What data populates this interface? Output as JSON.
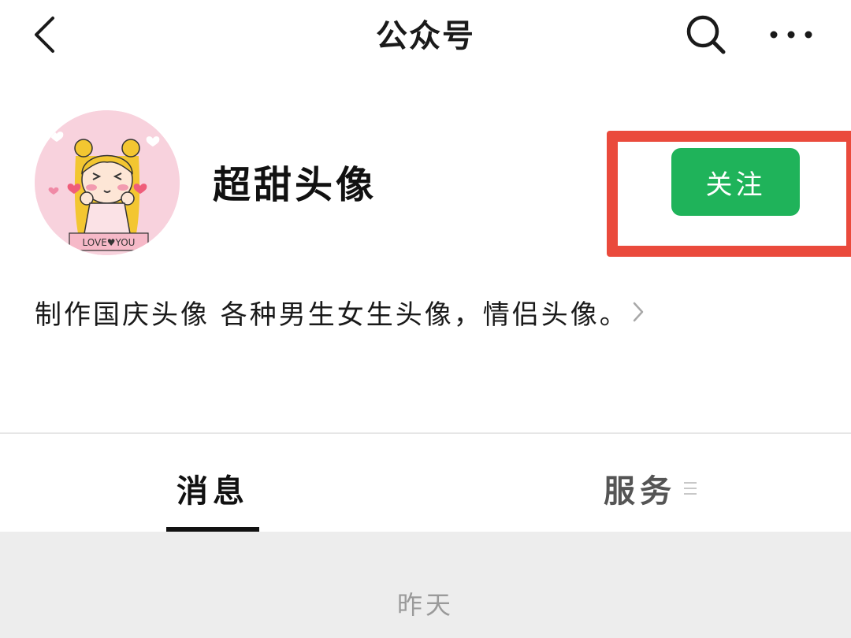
{
  "navbar": {
    "title": "公众号",
    "icons": [
      "back-chevron-icon",
      "search-icon",
      "more-icon"
    ]
  },
  "account": {
    "name": "超甜头像",
    "avatar_text": "LOVE♥YOU",
    "follow_label": "关注",
    "description": "制作国庆头像 各种男生女生头像，情侣头像。"
  },
  "tabs": [
    {
      "label": "消息",
      "active": true
    },
    {
      "label": "服务",
      "active": false
    }
  ],
  "feed": {
    "date_label": "昨天"
  },
  "colors": {
    "follow_green": "#1fb35a",
    "highlight_red": "#ea4a3c",
    "feed_background": "#ededed"
  }
}
